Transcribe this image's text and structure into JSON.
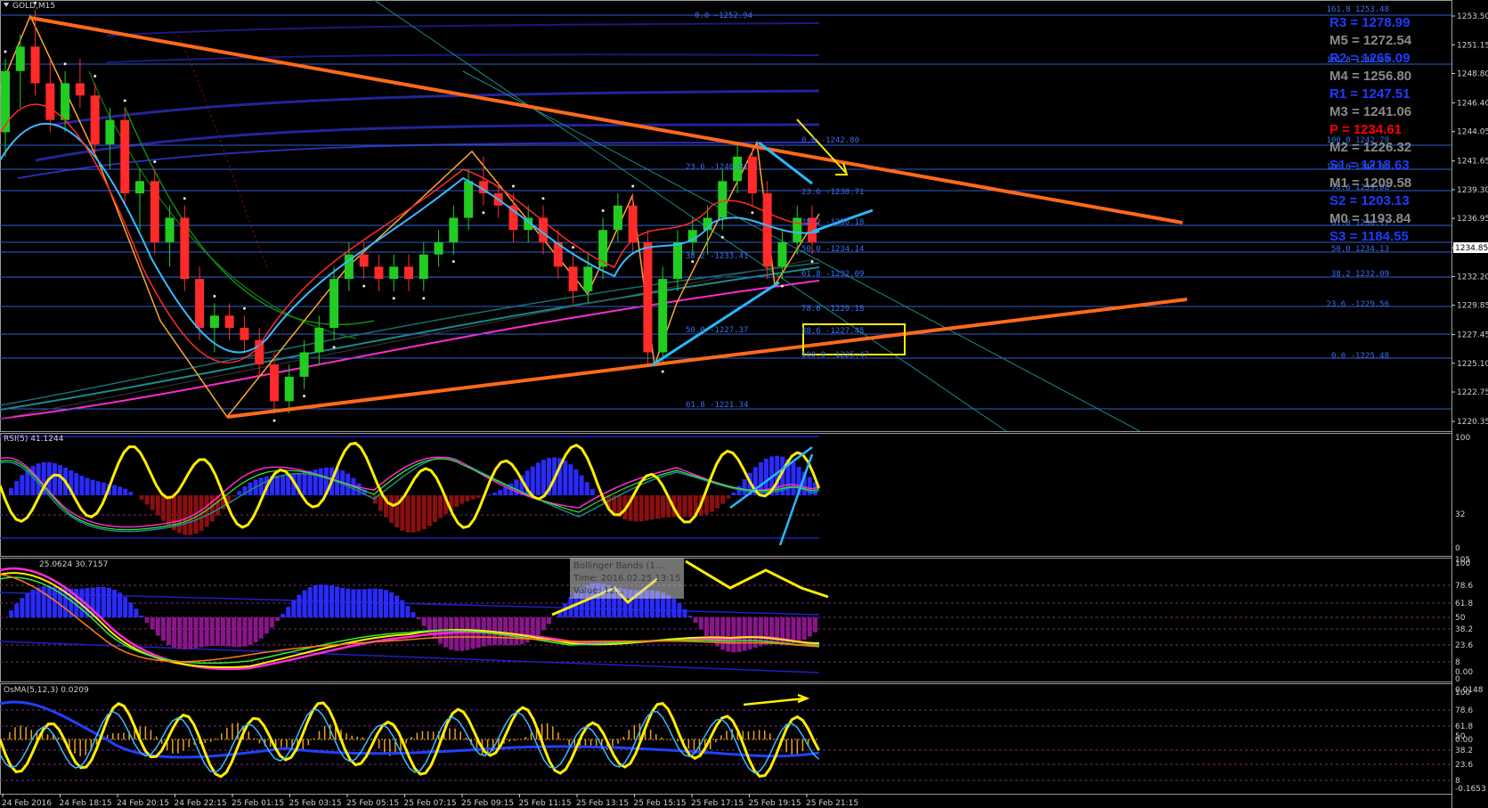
{
  "window": {
    "title": "GOLD,M15"
  },
  "colors": {
    "bg": "#000000",
    "grid": "#1a1a1a",
    "axis": "#cfcfcf",
    "bull": "#22cc22",
    "bear": "#ff2a2a",
    "trend": "#ff6a1a",
    "level": "#2f5fd0",
    "cyan": "#3ab8ff",
    "magenta": "#ff2ad4",
    "yellow": "#ffee00",
    "teal": "#1c8a8a",
    "navy": "#1a1a80",
    "pivot_blue": "#1e3cff",
    "pivot_gray": "#8a8a8a",
    "pivot_red": "#ff0000"
  },
  "main": {
    "price_axis": [
      "1253.50",
      "1251.15",
      "1248.80",
      "1246.40",
      "1244.05",
      "1241.65",
      "1239.30",
      "1236.95",
      "1234.55",
      "1232.20",
      "1229.85",
      "1227.45",
      "1225.10",
      "1222.75",
      "1220.35"
    ],
    "current_price": "1234.85",
    "fib_left": [
      {
        "text": "0.0 -1252.94"
      },
      {
        "text": "23.6 -1240.81"
      },
      {
        "text": "38.2 -1233.41"
      },
      {
        "text": "50.0 -1227.37"
      },
      {
        "text": "61.8 -1221.34"
      }
    ],
    "fib_mid": [
      {
        "text": "0.0 -1242.80"
      },
      {
        "text": "23.6 -1238.71"
      },
      {
        "text": "38.2 -1236.18"
      },
      {
        "text": "50.0 -1234.14"
      },
      {
        "text": "61.8 -1232.09"
      },
      {
        "text": "78.6 -1229.18"
      },
      {
        "text": "88.6 -1227.45"
      },
      {
        "text": "100.0 -1225.47"
      }
    ],
    "fib_right": [
      {
        "text": "161.8 1253.48"
      },
      {
        "text": "161.8 1249.40"
      },
      {
        "text": "100.0 1242.79"
      },
      {
        "text": "100.0 1240.81"
      },
      {
        "text": "78.6 1239.08"
      },
      {
        "text": "61.8 1236.17"
      },
      {
        "text": "50.0 1234.13"
      },
      {
        "text": "38.2 1232.09"
      },
      {
        "text": "23.6 -1229.56"
      },
      {
        "text": "0.0 -1225.48"
      }
    ],
    "pivots": [
      {
        "label": "R3 = 1278.99",
        "color": "blue"
      },
      {
        "label": "M5 = 1272.54",
        "color": "gray"
      },
      {
        "label": "R2 = 1265.09",
        "color": "blue"
      },
      {
        "label": "M4 = 1256.80",
        "color": "gray"
      },
      {
        "label": "R1 = 1247.51",
        "color": "blue"
      },
      {
        "label": "M3 = 1241.06",
        "color": "gray"
      },
      {
        "label": "P  = 1234.61",
        "color": "red"
      },
      {
        "label": "M2 = 1226.32",
        "color": "gray"
      },
      {
        "label": "S1 = 1218.63",
        "color": "blue"
      },
      {
        "label": "M1 = 1209.58",
        "color": "gray"
      },
      {
        "label": "S2 = 1203.13",
        "color": "blue"
      },
      {
        "label": "M0 = 1193.84",
        "color": "gray"
      },
      {
        "label": "S3 = 1184.55",
        "color": "blue"
      }
    ]
  },
  "rsi": {
    "label": "RSI(5) 41.1244",
    "axis": [
      "100",
      "32",
      "0"
    ]
  },
  "stoch": {
    "label": "25.0624 30.7157",
    "axis": [
      "105",
      "100",
      "78.6",
      "61.8",
      "50",
      "38.2",
      "23.6",
      "8",
      "0.00",
      "0"
    ]
  },
  "tooltip": {
    "line1": "Bollinger Bands (1…",
    "line2": "Time: 2016.02.25 13:15",
    "line3": "Value: 12…"
  },
  "osma": {
    "label": "OsMA(5,12,3) 0.0209",
    "axis": [
      "0.0148",
      "100",
      "78.6",
      "61.8",
      "50",
      "0.00",
      "38.2",
      "23.6",
      "8",
      "-0.1653"
    ]
  },
  "time_axis": [
    "24 Feb 2016",
    "24 Feb 18:15",
    "24 Feb 20:15",
    "24 Feb 22:15",
    "25 Feb 01:15",
    "25 Feb 03:15",
    "25 Feb 05:15",
    "25 Feb 07:15",
    "25 Feb 09:15",
    "25 Feb 11:15",
    "25 Feb 13:15",
    "25 Feb 15:15",
    "25 Feb 17:15",
    "25 Feb 19:15",
    "25 Feb 21:15"
  ],
  "candles": [
    [
      1244,
      1250,
      1242,
      1249
    ],
    [
      1249,
      1252,
      1246,
      1251
    ],
    [
      1251,
      1254,
      1247,
      1248
    ],
    [
      1248,
      1250,
      1244,
      1245
    ],
    [
      1245,
      1249,
      1244,
      1248
    ],
    [
      1248,
      1250,
      1246,
      1247
    ],
    [
      1247,
      1248,
      1242,
      1243
    ],
    [
      1243,
      1246,
      1241,
      1245
    ],
    [
      1245,
      1246,
      1238,
      1239
    ],
    [
      1239,
      1241,
      1236,
      1240
    ],
    [
      1240,
      1241,
      1234,
      1235
    ],
    [
      1235,
      1238,
      1233,
      1237
    ],
    [
      1237,
      1238,
      1231,
      1232
    ],
    [
      1232,
      1233,
      1227,
      1228
    ],
    [
      1228,
      1230,
      1226,
      1229
    ],
    [
      1229,
      1230,
      1227,
      1228
    ],
    [
      1228,
      1229,
      1226,
      1227
    ],
    [
      1227,
      1228,
      1224,
      1225
    ],
    [
      1225,
      1226,
      1221,
      1222
    ],
    [
      1222,
      1225,
      1221,
      1224
    ],
    [
      1224,
      1227,
      1223,
      1226
    ],
    [
      1226,
      1229,
      1225,
      1228
    ],
    [
      1228,
      1233,
      1227,
      1232
    ],
    [
      1232,
      1235,
      1231,
      1234
    ],
    [
      1234,
      1235,
      1232,
      1233
    ],
    [
      1233,
      1234,
      1231,
      1232
    ],
    [
      1232,
      1234,
      1231,
      1233
    ],
    [
      1233,
      1234,
      1231,
      1232
    ],
    [
      1232,
      1235,
      1231,
      1234
    ],
    [
      1234,
      1236,
      1233,
      1235
    ],
    [
      1235,
      1238,
      1234,
      1237
    ],
    [
      1237,
      1241,
      1236,
      1240
    ],
    [
      1240,
      1242,
      1238,
      1239
    ],
    [
      1239,
      1240,
      1237,
      1238
    ],
    [
      1238,
      1239,
      1235,
      1236
    ],
    [
      1236,
      1238,
      1235,
      1237
    ],
    [
      1237,
      1238,
      1234,
      1235
    ],
    [
      1235,
      1236,
      1232,
      1233
    ],
    [
      1233,
      1234,
      1230,
      1231
    ],
    [
      1231,
      1234,
      1230,
      1233
    ],
    [
      1233,
      1237,
      1232,
      1236
    ],
    [
      1236,
      1239,
      1235,
      1238
    ],
    [
      1238,
      1239,
      1234,
      1235
    ],
    [
      1235,
      1236,
      1225,
      1226
    ],
    [
      1226,
      1233,
      1225,
      1232
    ],
    [
      1232,
      1236,
      1231,
      1235
    ],
    [
      1235,
      1237,
      1234,
      1236
    ],
    [
      1236,
      1238,
      1234,
      1237
    ],
    [
      1237,
      1241,
      1236,
      1240
    ],
    [
      1240,
      1243,
      1239,
      1242
    ],
    [
      1242,
      1243,
      1238,
      1239
    ],
    [
      1239,
      1240,
      1232,
      1233
    ],
    [
      1233,
      1236,
      1232,
      1235
    ],
    [
      1235,
      1238,
      1234,
      1237
    ],
    [
      1237,
      1238,
      1234,
      1235
    ]
  ]
}
